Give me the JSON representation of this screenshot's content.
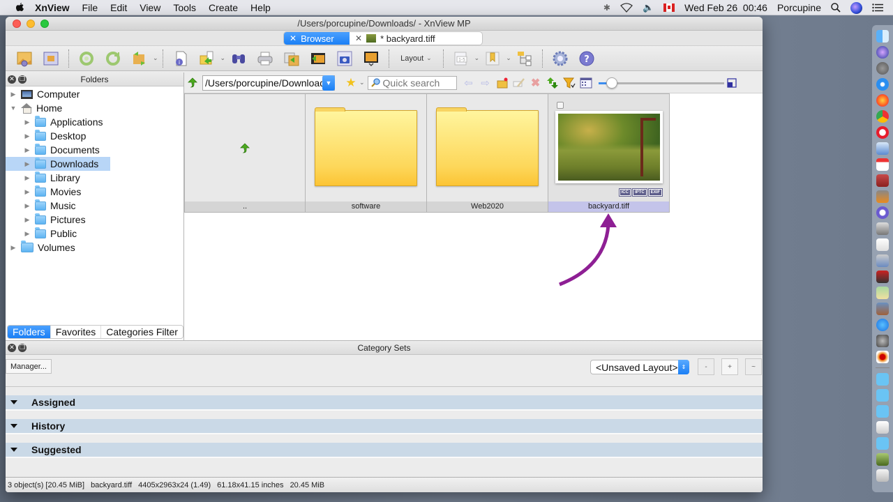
{
  "menubar": {
    "app_name": "XnView",
    "items": [
      "File",
      "Edit",
      "View",
      "Tools",
      "Create",
      "Help"
    ],
    "datetime": "Wed Feb 26  00:46",
    "user": "Porcupine"
  },
  "window": {
    "title": "/Users/porcupine/Downloads/ - XnView MP",
    "tabs": [
      {
        "label": "Browser",
        "active": true
      },
      {
        "label": "* backyard.tiff",
        "active": false
      }
    ]
  },
  "toolbar": {
    "layout_label": "Layout",
    "icons": [
      "open-image-icon",
      "fullscreen-icon",
      "rotate-left-icon",
      "rotate-right-icon",
      "convert-icon",
      "info-icon",
      "move-copy-icon",
      "find-icon",
      "print-icon",
      "batch-convert-icon",
      "capture-icon",
      "slideshow-icon",
      "page-range-icon",
      "bookmark-icon",
      "folder-tree-icon",
      "settings-icon",
      "help-icon"
    ]
  },
  "folders_panel": {
    "title": "Folders",
    "tree": [
      {
        "label": "Computer",
        "level": 0,
        "expanded": false
      },
      {
        "label": "Home",
        "level": 0,
        "expanded": true
      },
      {
        "label": "Applications",
        "level": 1
      },
      {
        "label": "Desktop",
        "level": 1
      },
      {
        "label": "Documents",
        "level": 1
      },
      {
        "label": "Downloads",
        "level": 1,
        "selected": true
      },
      {
        "label": "Library",
        "level": 1
      },
      {
        "label": "Movies",
        "level": 1
      },
      {
        "label": "Music",
        "level": 1
      },
      {
        "label": "Pictures",
        "level": 1
      },
      {
        "label": "Public",
        "level": 1
      },
      {
        "label": "Volumes",
        "level": 0
      }
    ],
    "tabs": [
      "Folders",
      "Favorites",
      "Categories Filter"
    ]
  },
  "browser": {
    "path": "/Users/porcupine/Downloads/",
    "search_placeholder": "Quick search",
    "thumbnail_size_fraction": 0.07,
    "items": [
      {
        "name": "..",
        "type": "parent"
      },
      {
        "name": "software",
        "type": "folder"
      },
      {
        "name": "Web2020",
        "type": "folder"
      },
      {
        "name": "backyard.tiff",
        "type": "image",
        "selected": true,
        "badges": [
          "ICC",
          "IPTC",
          "EXIF"
        ]
      }
    ],
    "annotation_color": "#8e1f94"
  },
  "category_sets": {
    "title": "Category Sets",
    "manager_label": "Manager...",
    "layout_value": "<Unsaved Layout>",
    "btn_minus": "-",
    "btn_plus": "+",
    "btn_tilde": "~",
    "sections": [
      "Assigned",
      "History",
      "Suggested"
    ]
  },
  "status": {
    "count": "3 object(s) [20.45 MiB]",
    "file": "backyard.tiff",
    "dimensions": "4405x2963x24 (1.49)",
    "print_size": "61.18x41.15 inches",
    "size": "20.45 MiB"
  },
  "dock": {
    "apps": [
      "finder",
      "siri",
      "launchpad",
      "safari",
      "firefox",
      "chrome",
      "opera",
      "mail",
      "calendar",
      "dictionary",
      "calculator",
      "bbedit",
      "preview-screenshot",
      "textedit",
      "image-capture",
      "photo-booth",
      "maps",
      "photos",
      "app-store",
      "system-preferences",
      "xnview"
    ],
    "folders": [
      "applications-folder",
      "documents-folder",
      "downloads-folder",
      "file-stack",
      "folder-stack",
      "image-stack",
      "trash"
    ]
  }
}
